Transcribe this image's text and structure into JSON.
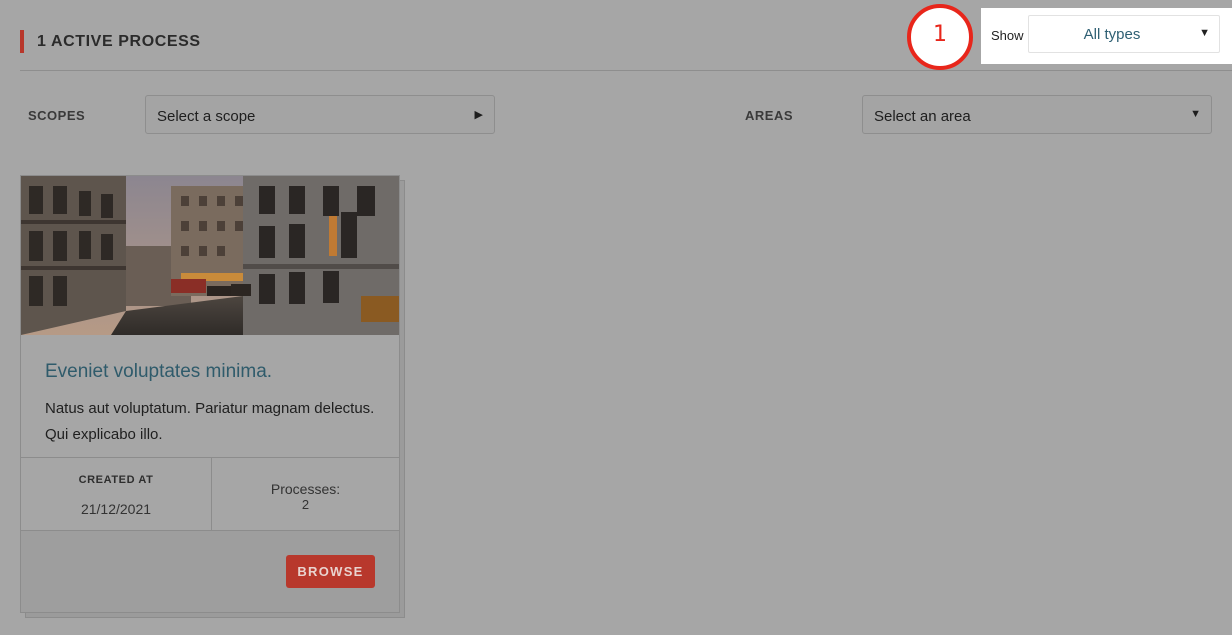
{
  "header": {
    "title": "1 ACTIVE PROCESS"
  },
  "show_filter": {
    "label": "Show",
    "selected": "All types"
  },
  "step_marker": {
    "label": "1",
    "color": "#e8261b"
  },
  "filters": {
    "scopes": {
      "label": "SCOPES",
      "selected": "Select a scope"
    },
    "areas": {
      "label": "AREAS",
      "selected": "Select an area"
    }
  },
  "card": {
    "title": "Eveniet voluptates minima.",
    "description": "Natus aut voluptatum. Pariatur magnam delectus. Qui explicabo illo.",
    "created_at_label": "CREATED AT",
    "created_at_value": "21/12/2021",
    "processes_label": "Processes:",
    "processes_value": "2",
    "browse_label": "BROWSE"
  },
  "colors": {
    "accent": "#b8372b",
    "title_link": "#2f5b6b",
    "overlay_bg": "#a6a6a6"
  }
}
